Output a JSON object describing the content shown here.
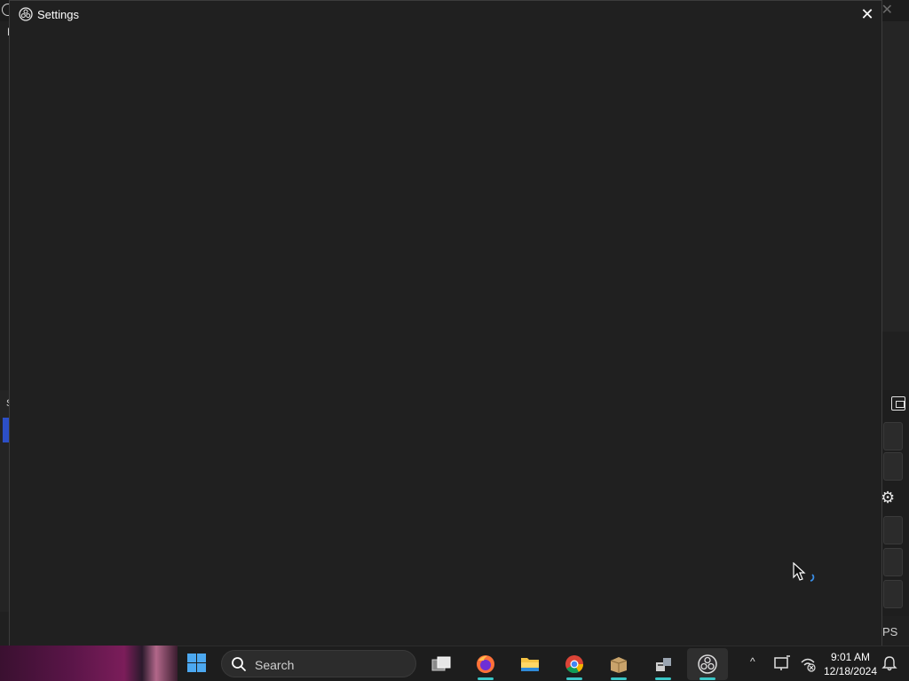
{
  "settings_window": {
    "title": "Settings",
    "close_glyph": "✕"
  },
  "background_app": {
    "menu_letter": "F",
    "left_dock_letter": "S",
    "status_fps": "PS",
    "close_glyph": "✕",
    "gear_glyph": "⚙"
  },
  "taskbar": {
    "search_placeholder": "Search",
    "apps": [
      "task-view",
      "firefox",
      "file-explorer",
      "chrome",
      "archive-manager",
      "network-app",
      "obs-studio"
    ],
    "active_app": "obs-studio",
    "tray_chevron": "^",
    "clock_time": "9:01 AM",
    "clock_date": "12/18/2024"
  },
  "colors": {
    "accent_underline": "#3ac6c6",
    "windows_blue": "#4ca8f0"
  }
}
